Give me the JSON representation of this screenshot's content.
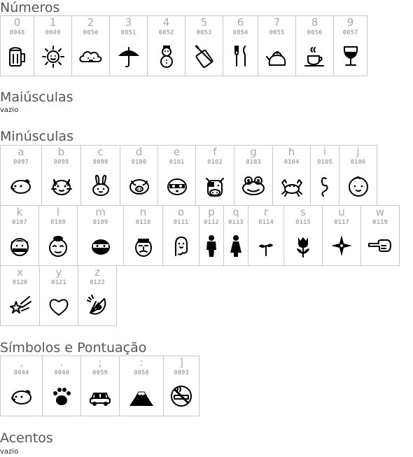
{
  "sections": {
    "numeros": {
      "title": "Números"
    },
    "maiusculas": {
      "title": "Maiúsculas",
      "note": "vazio"
    },
    "minusculas": {
      "title": "Minúsculas"
    },
    "simbolos": {
      "title": "Símbolos e Pontuação"
    },
    "acentos": {
      "title": "Acentos",
      "note": "vazio"
    }
  },
  "numeros": [
    {
      "char": "0",
      "code": "0048",
      "icon": "beer-mug-icon"
    },
    {
      "char": "1",
      "code": "0049",
      "icon": "sun-icon"
    },
    {
      "char": "2",
      "code": "0050",
      "icon": "cloud-icon"
    },
    {
      "char": "3",
      "code": "0051",
      "icon": "umbrella-icon"
    },
    {
      "char": "4",
      "code": "0052",
      "icon": "snowman-icon"
    },
    {
      "char": "5",
      "code": "0053",
      "icon": "knife-board-icon"
    },
    {
      "char": "6",
      "code": "0054",
      "icon": "fork-knife-icon"
    },
    {
      "char": "7",
      "code": "0055",
      "icon": "kettle-icon"
    },
    {
      "char": "8",
      "code": "0056",
      "icon": "coffee-cup-icon"
    },
    {
      "char": "9",
      "code": "0057",
      "icon": "wine-glass-icon"
    }
  ],
  "minusculas_row1": [
    {
      "char": "a",
      "code": "0097",
      "icon": "dog-face-icon"
    },
    {
      "char": "b",
      "code": "0098",
      "icon": "cat-face-icon"
    },
    {
      "char": "c",
      "code": "0099",
      "icon": "rabbit-face-icon"
    },
    {
      "char": "d",
      "code": "0100",
      "icon": "pig-face-icon"
    },
    {
      "char": "e",
      "code": "0101",
      "icon": "raccoon-face-icon"
    },
    {
      "char": "f",
      "code": "0102",
      "icon": "cow-face-icon"
    },
    {
      "char": "g",
      "code": "0103",
      "icon": "frog-face-icon"
    },
    {
      "char": "h",
      "code": "0104",
      "icon": "crab-icon"
    },
    {
      "char": "i",
      "code": "0105",
      "icon": "snake-icon"
    },
    {
      "char": "j",
      "code": "0106",
      "icon": "baby-face-icon"
    }
  ],
  "minusculas_row2": [
    {
      "char": "k",
      "code": "0107",
      "icon": "boxer-face-icon"
    },
    {
      "char": "l",
      "code": "0108",
      "icon": "sumo-face-icon"
    },
    {
      "char": "m",
      "code": "0109",
      "icon": "ninja-face-icon"
    },
    {
      "char": "n",
      "code": "0110",
      "icon": "samurai-face-icon"
    },
    {
      "char": "o",
      "code": "0111",
      "icon": "ghost-icon"
    },
    {
      "char": "p",
      "code": "0112",
      "icon": "man-silhouette-icon"
    },
    {
      "char": "q",
      "code": "0113",
      "icon": "woman-silhouette-icon"
    },
    {
      "char": "r",
      "code": "0114",
      "icon": "sprout-icon"
    },
    {
      "char": "s",
      "code": "0115",
      "icon": "tulip-icon"
    },
    {
      "char": "u",
      "code": "0117",
      "icon": "shuriken-icon"
    },
    {
      "char": "w",
      "code": "0119",
      "icon": "pointing-hand-icon"
    }
  ],
  "minusculas_row3": [
    {
      "char": "x",
      "code": "0120",
      "icon": "shooting-star-icon"
    },
    {
      "char": "y",
      "code": "0121",
      "icon": "heart-icon"
    },
    {
      "char": "z",
      "code": "0122",
      "icon": "hand-fan-icon"
    }
  ],
  "simbolos": [
    {
      "char": ",",
      "code": "0044",
      "icon": "dog-face-icon"
    },
    {
      "char": ".",
      "code": "0046",
      "icon": "paw-print-icon"
    },
    {
      "char": ";",
      "code": "0059",
      "icon": "car-icon"
    },
    {
      "char": ":",
      "code": "0058",
      "icon": "mount-fuji-icon"
    },
    {
      "char": "]",
      "code": "0093",
      "icon": "no-smoking-icon"
    }
  ]
}
